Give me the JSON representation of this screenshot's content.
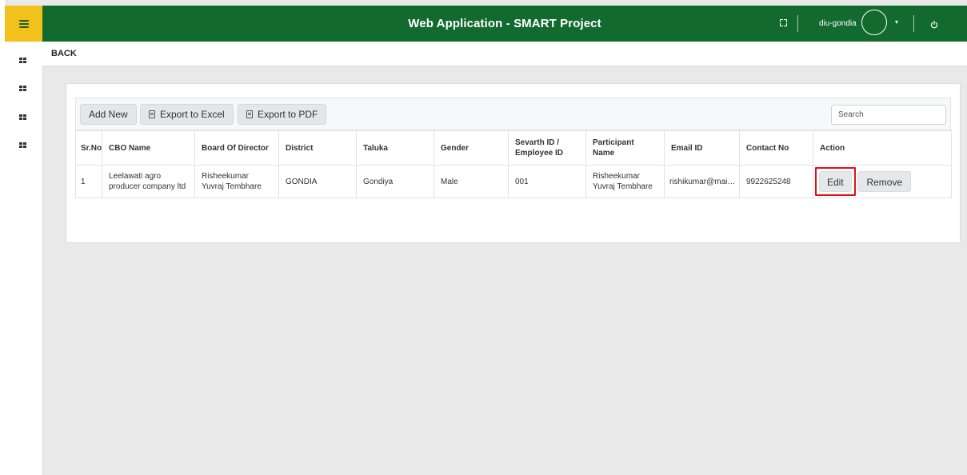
{
  "header": {
    "title": "Web Application - SMART Project",
    "username": "diu-gondia"
  },
  "nav": {
    "back_label": "BACK"
  },
  "toolbar": {
    "add_new_label": "Add New",
    "export_excel_label": "Export to Excel",
    "export_pdf_label": "Export to PDF",
    "search_placeholder": "Search"
  },
  "table": {
    "columns": [
      "Sr.No",
      "CBO Name",
      "Board Of Director",
      "District",
      "Taluka",
      "Gender",
      "Sevarth ID / Employee ID",
      "Participant Name",
      "Email ID",
      "Contact No",
      "Action"
    ],
    "rows": [
      {
        "sr_no": "1",
        "cbo_name": "Leelawati agro producer company ltd",
        "board_of_director": "Risheekumar Yuvraj Tembhare",
        "district": "GONDIA",
        "taluka": "Gondiya",
        "gender": "Male",
        "employee_id": "001",
        "participant_name": "Risheekumar Yuvraj Tembhare",
        "email": "rishikumar@maili...",
        "contact": "9922625248",
        "edit_label": "Edit",
        "remove_label": "Remove"
      }
    ]
  },
  "colors": {
    "header_green": "#126a2f",
    "menu_yellow": "#f2c21a",
    "highlight_red": "#e10f17"
  },
  "icons": {
    "menu": "hamburger-icon",
    "sidebar": "grid-icon",
    "fullscreen": "fullscreen-icon",
    "user_menu": "caret-down-icon",
    "power": "power-icon",
    "export": "document-icon"
  }
}
